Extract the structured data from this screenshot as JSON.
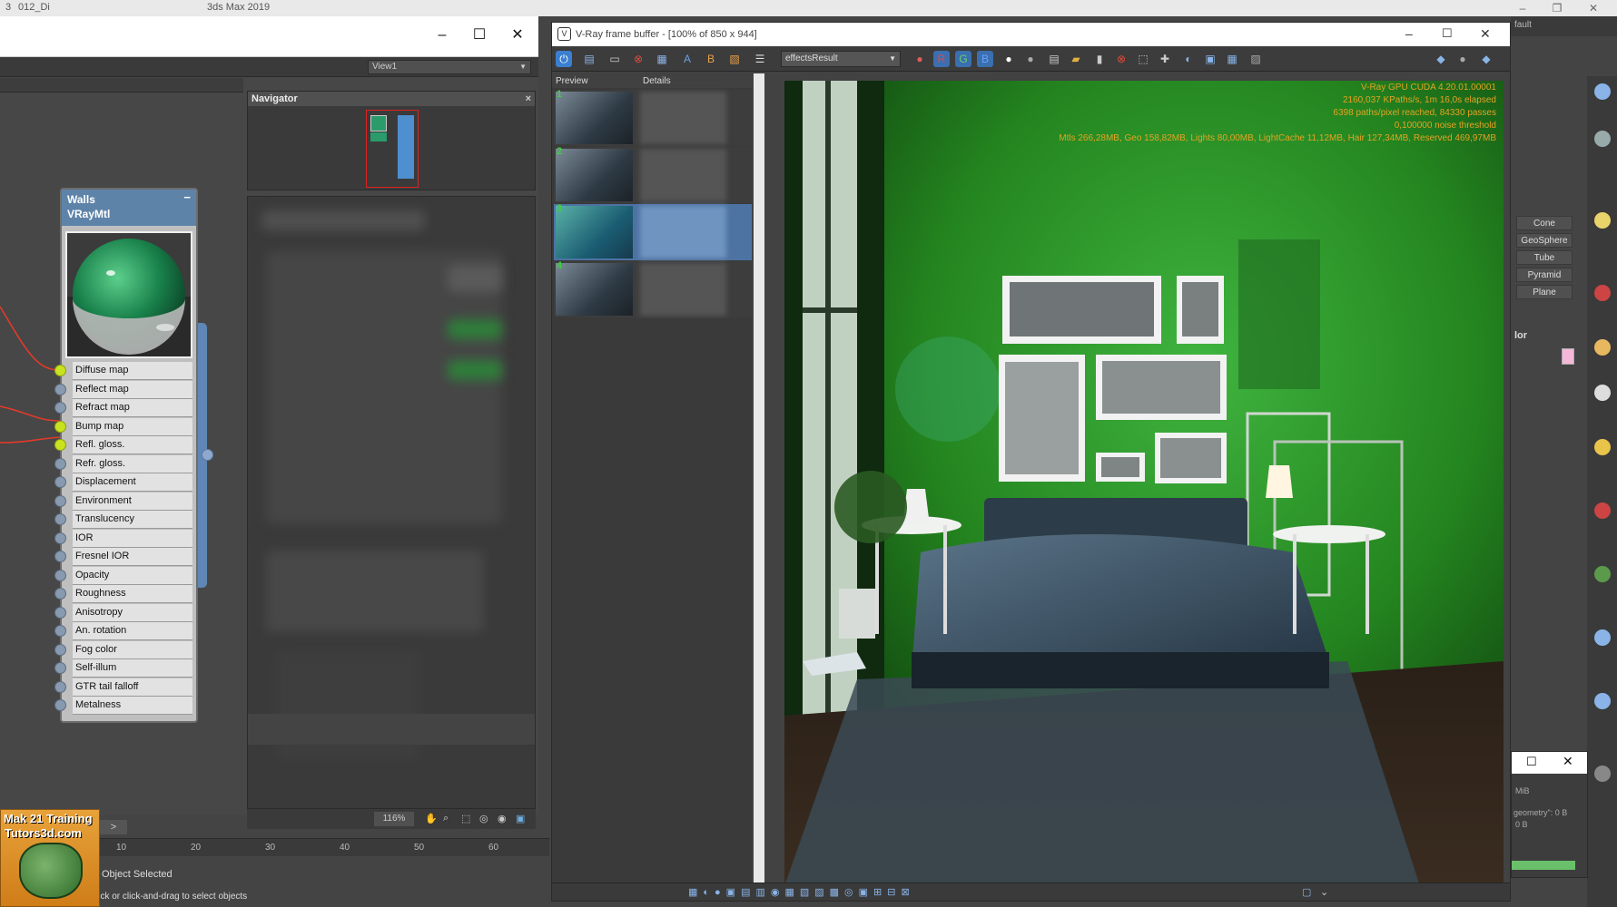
{
  "max": {
    "file_title": "012_Di",
    "app_title": "3ds Max 2019",
    "panel_label": "fault"
  },
  "slate": {
    "view_select": "View1",
    "navigator_title": "Navigator",
    "navigator_close": "×",
    "zoom": "116%",
    "node": {
      "name": "Walls",
      "type": "VRayMtl",
      "collapse": "−",
      "slots": [
        {
          "label": "Diffuse map",
          "connected": true
        },
        {
          "label": "Reflect map",
          "connected": false
        },
        {
          "label": "Refract map",
          "connected": false
        },
        {
          "label": "Bump map",
          "connected": true
        },
        {
          "label": "Refl. gloss.",
          "connected": true
        },
        {
          "label": "Refr. gloss.",
          "connected": false
        },
        {
          "label": "Displacement",
          "connected": false
        },
        {
          "label": "Environment",
          "connected": false
        },
        {
          "label": "Translucency",
          "connected": false
        },
        {
          "label": "IOR",
          "connected": false
        },
        {
          "label": "Fresnel IOR",
          "connected": false
        },
        {
          "label": "Opacity",
          "connected": false
        },
        {
          "label": "Roughness",
          "connected": false
        },
        {
          "label": "Anisotropy",
          "connected": false
        },
        {
          "label": "An. rotation",
          "connected": false
        },
        {
          "label": "Fog color",
          "connected": false
        },
        {
          "label": "Self-illum",
          "connected": false
        },
        {
          "label": "GTR tail falloff",
          "connected": false
        },
        {
          "label": "Metalness",
          "connected": false
        }
      ]
    }
  },
  "timeline": {
    "ticks": [
      "10",
      "20",
      "30",
      "40",
      "50",
      "60"
    ]
  },
  "status": {
    "line1": "Object Selected",
    "line2": "lick or click-and-drag to select objects"
  },
  "logo": {
    "line1": "Mak 21 Training",
    "line2": "Tutors3d.com"
  },
  "vfb": {
    "title": "V-Ray frame buffer - [100% of 850 x 944]",
    "channel": "effectsResult",
    "history_headers": {
      "preview": "Preview",
      "details": "Details"
    },
    "history": [
      {
        "num": "1",
        "selected": false
      },
      {
        "num": "2",
        "selected": false
      },
      {
        "num": "3",
        "selected": true
      },
      {
        "num": "4",
        "selected": false
      }
    ],
    "stats": [
      "V-Ray GPU CUDA 4.20.01.00001",
      "2160,037 KPaths/s, 1m 16,0s elapsed",
      "6398 paths/pixel reached, 84330 passes",
      "0,100000 noise threshold",
      "Mtls 266,28MB, Geo 158,82MB, Lights 80,00MB, LightCache 11,12MB, Hair 127,34MB, Reserved 469,97MB"
    ],
    "colors": {
      "wall": "#2e9a2e",
      "stats_text": "#e3a323"
    }
  },
  "cmdpanel": {
    "primitives": [
      "Cone",
      "GeoSphere",
      "Tube",
      "Pyramid",
      "Plane"
    ],
    "section_label": "lor",
    "mem_lines": [
      "MiB",
      "geometry\": 0 B",
      "0 B"
    ]
  }
}
